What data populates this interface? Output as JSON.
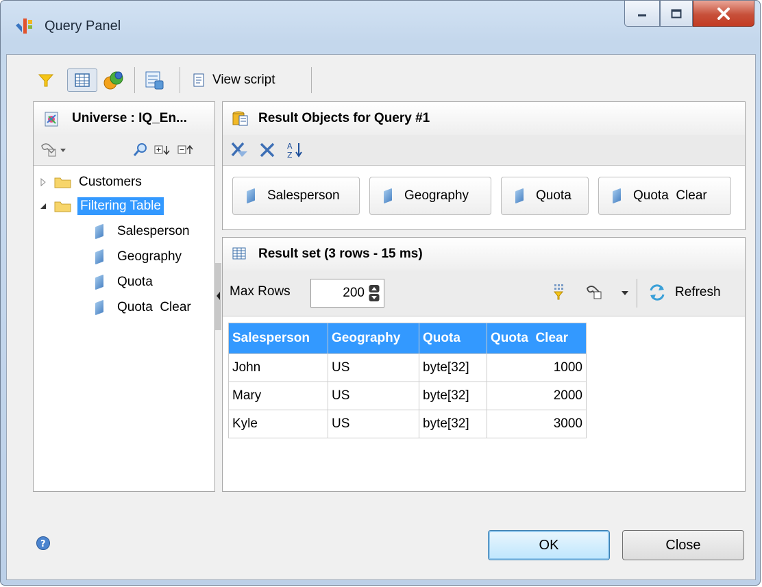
{
  "window": {
    "title": "Query Panel"
  },
  "toolbar": {
    "view_script_label": "View script"
  },
  "universe_panel": {
    "title": "Universe : IQ_En...",
    "tree": [
      {
        "label": "Customers",
        "type": "folder",
        "expanded": false
      },
      {
        "label": "Filtering Table",
        "type": "folder",
        "expanded": true,
        "selected": true
      }
    ],
    "children": [
      "Salesperson",
      "Geography",
      "Quota",
      "Quota  Clear"
    ]
  },
  "result_objects": {
    "title": "Result Objects for Query #1",
    "objects": [
      "Salesperson",
      "Geography",
      "Quota",
      "Quota  Clear"
    ]
  },
  "result_set": {
    "title": "Result set (3 rows - 15 ms)",
    "max_rows_label": "Max Rows",
    "max_rows_value": "200",
    "refresh_label": "Refresh",
    "columns": [
      "Salesperson",
      "Geography",
      "Quota",
      "Quota  Clear"
    ],
    "rows": [
      [
        "John",
        "US",
        "byte[32]",
        "1000"
      ],
      [
        "Mary",
        "US",
        "byte[32]",
        "2000"
      ],
      [
        "Kyle",
        "US",
        "byte[32]",
        "3000"
      ]
    ]
  },
  "footer": {
    "ok_label": "OK",
    "close_label": "Close"
  },
  "colors": {
    "selection": "#3399ff",
    "header": "#3399ff"
  }
}
